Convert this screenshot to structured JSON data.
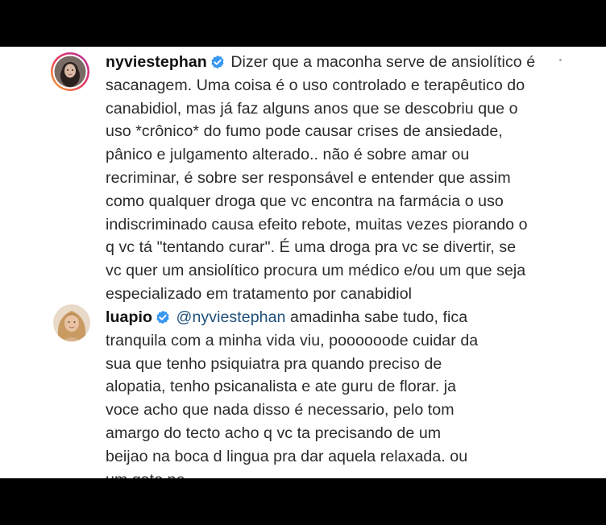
{
  "comments": [
    {
      "username": "nyviestephan",
      "verified": true,
      "avatar": "avatar-nyviestephan",
      "first_line": "Dizer que a maconha serve de ansiolítico é",
      "lines": [
        "sacanagem. Uma coisa é o uso controlado e terapêutico do",
        "canabidiol, mas já faz alguns anos que se descobriu que o",
        "uso *crônico* do fumo pode causar crises de ansiedade,",
        "pânico e julgamento alterado.. não é sobre amar ou",
        "recriminar, é sobre ser responsável e entender que assim",
        "como qualquer droga que vc encontra na farmácia o uso",
        "indiscriminado causa efeito rebote, muitas vezes piorando o",
        "q vc tá \"tentando curar\". É uma droga pra vc se divertir, se",
        "vc quer um ansiolítico procura um médico e/ou um que seja",
        "especializado em tratamento por canabidiol"
      ]
    },
    {
      "username": "luapio",
      "verified": true,
      "avatar": "avatar-luapio",
      "mention": "@nyviestephan",
      "first_line": "amadinha sabe tudo, fica",
      "lines": [
        "tranquila com a minha vida viu, poooooode cuidar da",
        "sua que tenho psiquiatra pra quando preciso de",
        "alopatia, tenho psicanalista e ate guru de florar. ja",
        "voce acho que nada disso é necessario, pelo tom",
        "amargo do tecto acho q vc ta precisando de um",
        "beijao na boca d lingua pra dar aquela relaxada. ou",
        "um gato ne..."
      ]
    }
  ],
  "colors": {
    "verified_badge": "#3897f0",
    "mention": "#1f4f7a",
    "text": "#2b2b2b",
    "background": "#ffffff",
    "letterbox": "#000000"
  }
}
